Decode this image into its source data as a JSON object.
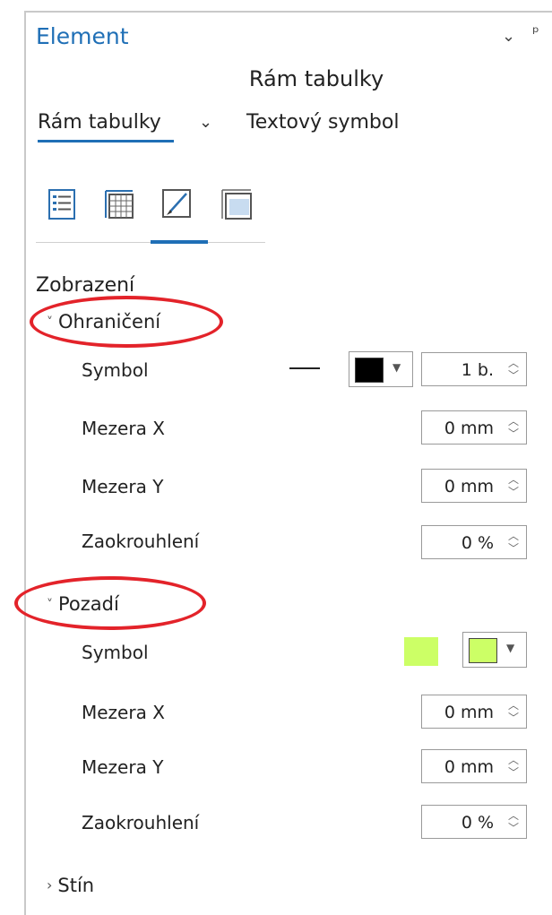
{
  "panel": {
    "title": "Element",
    "subtitle": "Rám tabulky"
  },
  "tabs": {
    "active_label": "Rám tabulky",
    "second_label": "Textový symbol"
  },
  "toolbar_icons": [
    "options-icon",
    "table-icon",
    "paint-brush-icon",
    "placement-icon"
  ],
  "section_title": "Zobrazení",
  "border": {
    "group_label": "Ohraničení",
    "symbol_label": "Symbol",
    "symbol_color": "#000000",
    "symbol_width": "1 b.",
    "gap_x_label": "Mezera X",
    "gap_x_value": "0 mm",
    "gap_y_label": "Mezera Y",
    "gap_y_value": "0 mm",
    "rounding_label": "Zaokrouhlení",
    "rounding_value": "0 %"
  },
  "background": {
    "group_label": "Pozadí",
    "symbol_label": "Symbol",
    "symbol_color": "#ccff66",
    "gap_x_label": "Mezera X",
    "gap_x_value": "0 mm",
    "gap_y_label": "Mezera Y",
    "gap_y_value": "0 mm",
    "rounding_label": "Zaokrouhlení",
    "rounding_value": "0 %"
  },
  "shadow": {
    "group_label": "Stín"
  },
  "colors": {
    "accent": "#1f6fb6",
    "annotation": "#e3232a"
  }
}
